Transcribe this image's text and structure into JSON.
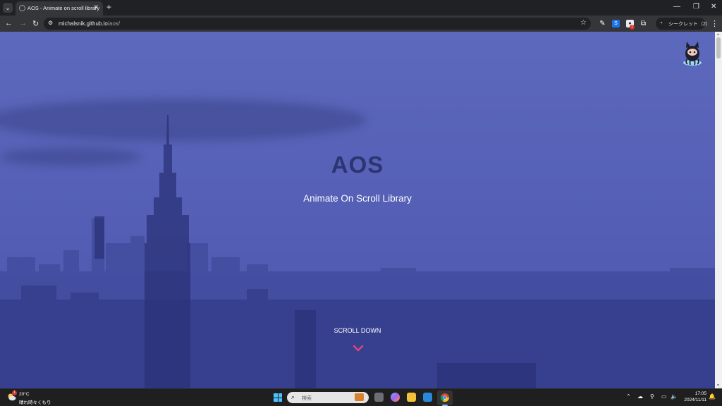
{
  "browser": {
    "tab_title": "AOS - Animate on scroll library",
    "url_host": "michalsnik.github.io",
    "url_path": "/aos/",
    "incognito_label": "シークレット（2）",
    "extension_badge": "1"
  },
  "page": {
    "title": "AOS",
    "subtitle": "Animate On Scroll Library",
    "scroll_label": "SCROLL DOWN",
    "accent_color": "#e0457b",
    "overlay_color": "#5a65b9"
  },
  "taskbar": {
    "weather_temp": "20°C",
    "weather_desc": "晴れ時々くもり",
    "weather_badge": "1",
    "search_placeholder": "検索",
    "time": "17:05",
    "date": "2024/11/11"
  }
}
